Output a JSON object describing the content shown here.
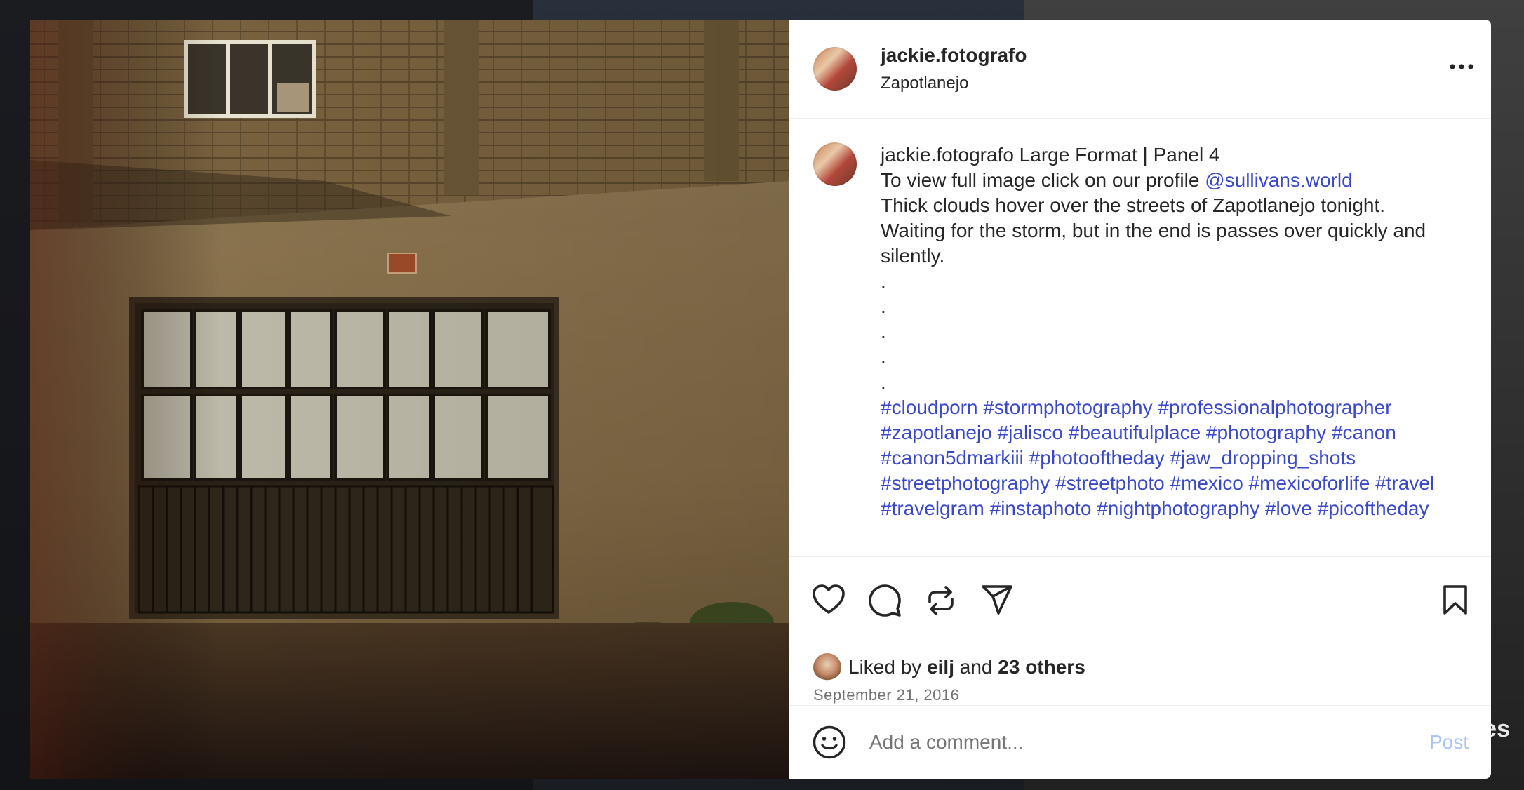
{
  "post": {
    "username": "jackie.fotografo",
    "location": "Zapotlanejo",
    "more_icon": "more-horizontal-icon",
    "caption": {
      "username": "jackie.fotografo",
      "title": "Large Format | Panel 4",
      "line1": "To view full image click on our profile",
      "mention": "@sullivans.world",
      "line2": "Thick clouds hover over the streets of Zapotlanejo tonight.",
      "line3": "Waiting for the storm, but in the end is passes over quickly and silently.",
      "dots": [
        ".",
        ".",
        ".",
        ".",
        "."
      ],
      "hashtags": [
        "#cloudporn",
        "#stormphotography",
        "#professionalphotographer",
        "#zapotlanejo",
        "#jalisco",
        "#beautifulplace",
        "#photography",
        "#canon",
        "#canon5dmarkiii",
        "#photooftheday",
        "#jaw_dropping_shots",
        "#streetphotography",
        "#streetphoto",
        "#mexico",
        "#mexicoforlife",
        "#travel",
        "#travelgram",
        "#instaphoto",
        "#nightphotography",
        "#love",
        "#picoftheday"
      ]
    },
    "actions": [
      "heart-icon",
      "comment-icon",
      "repost-icon",
      "share-icon",
      "bookmark-icon"
    ],
    "likes": {
      "prefix": "Liked by",
      "user": "eilj",
      "middle": "and",
      "others": "23 others"
    },
    "date": "September 21, 2016",
    "comment": {
      "placeholder": "Add a comment...",
      "post_label": "Post"
    },
    "background_peek_text": "es"
  },
  "colors": {
    "link": "#3949c9",
    "post_button": "#a9c4f5",
    "text": "#262626",
    "muted": "#737373"
  }
}
